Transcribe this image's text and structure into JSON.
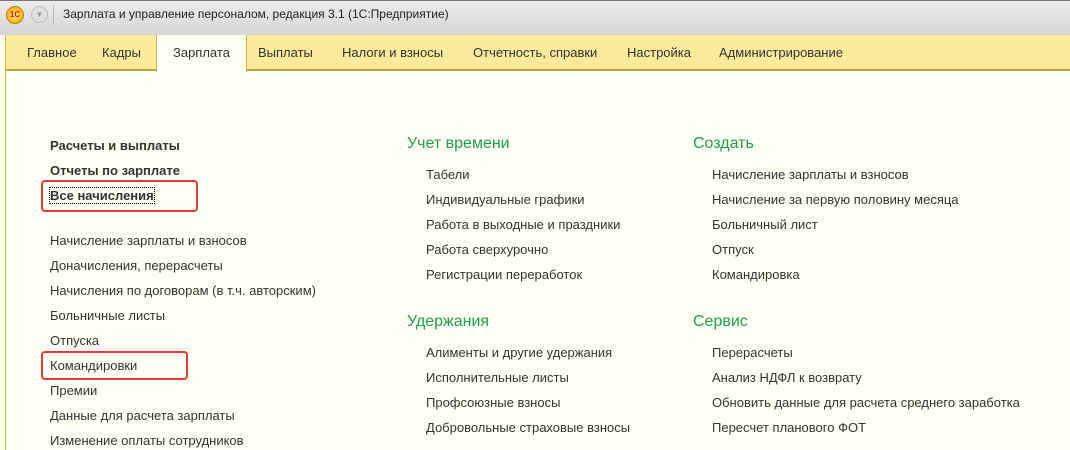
{
  "window": {
    "title": "Зарплата и управление персоналом, редакция 3.1  (1С:Предприятие)",
    "logo": "1С"
  },
  "tabs": [
    "Главное",
    "Кадры",
    "Зарплата",
    "Выплаты",
    "Налоги и взносы",
    "Отчетность, справки",
    "Настройка",
    "Администрирование"
  ],
  "active_tab": "Зарплата",
  "left": {
    "bold": [
      "Расчеты и выплаты",
      "Отчеты по зарплате",
      "Все начисления"
    ],
    "items": [
      "Начисление зарплаты и взносов",
      "Доначисления, перерасчеты",
      "Начисления по договорам (в т.ч. авторским)",
      "Больничные листы",
      "Отпуска",
      "Командировки",
      "Премии",
      "Данные для расчета зарплаты",
      "Изменение оплаты сотрудников"
    ]
  },
  "middle": {
    "time_header": "Учет времени",
    "time_items": [
      "Табели",
      "Индивидуальные графики",
      "Работа в выходные и праздники",
      "Работа сверхурочно",
      "Регистрации переработок"
    ],
    "ded_header": "Удержания",
    "ded_items": [
      "Алименты и другие удержания",
      "Исполнительные листы",
      "Профсоюзные взносы",
      "Добровольные страховые взносы"
    ]
  },
  "right": {
    "create_header": "Создать",
    "create_items": [
      "Начисление зарплаты и взносов",
      "Начисление за первую половину месяца",
      "Больничный лист",
      "Отпуск",
      "Командировка"
    ],
    "service_header": "Сервис",
    "service_items": [
      "Перерасчеты",
      "Анализ НДФЛ к возврату",
      "Обновить данные для расчета среднего заработка",
      "Пересчет планового ФОТ"
    ]
  },
  "colors": {
    "accent": "#1f9d4f",
    "highlight": "#e03a3a",
    "tabbar": "#fbea9b"
  }
}
